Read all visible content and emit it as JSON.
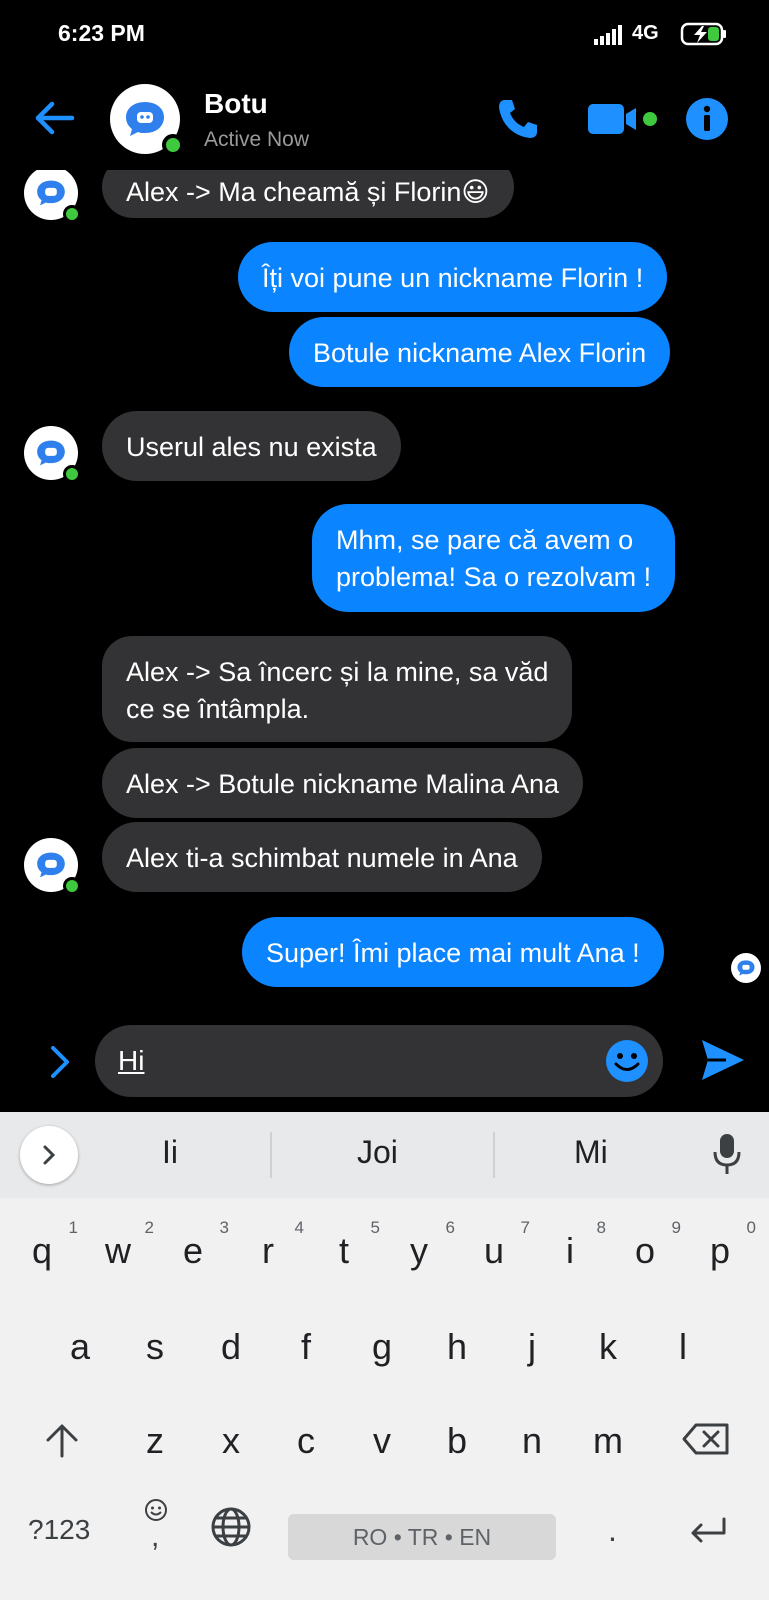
{
  "status_bar": {
    "time": "6:23 PM",
    "network": "4G"
  },
  "header": {
    "name": "Botu",
    "status": "Active Now"
  },
  "messages": [
    {
      "from": "in",
      "text": "Alex -> Ma cheamă și Florin😃"
    },
    {
      "from": "out",
      "text": "Îți voi pune un nickname Florin !"
    },
    {
      "from": "out",
      "text": "Botule nickname Alex Florin"
    },
    {
      "from": "in",
      "text": "Userul ales nu exista"
    },
    {
      "from": "out",
      "text": "Mhm, se pare că avem o"
    },
    {
      "from": "out",
      "text": "problema! Sa o rezolvam !"
    },
    {
      "from": "in",
      "text": "Alex -> Sa încerc și la mine, sa văd"
    },
    {
      "from": "in",
      "text": "ce se întâmpla."
    },
    {
      "from": "in",
      "text": "Alex -> Botule nickname Malina Ana"
    },
    {
      "from": "in",
      "text": "Alex ti-a schimbat numele in Ana"
    },
    {
      "from": "out",
      "text": "Super! Îmi place mai mult Ana !"
    }
  ],
  "composer": {
    "text": "Hi"
  },
  "keyboard": {
    "suggestions": [
      "Ii",
      "Joi",
      "Mi"
    ],
    "row1": [
      {
        "k": "q",
        "h": "1"
      },
      {
        "k": "w",
        "h": "2"
      },
      {
        "k": "e",
        "h": "3"
      },
      {
        "k": "r",
        "h": "4"
      },
      {
        "k": "t",
        "h": "5"
      },
      {
        "k": "y",
        "h": "6"
      },
      {
        "k": "u",
        "h": "7"
      },
      {
        "k": "i",
        "h": "8"
      },
      {
        "k": "o",
        "h": "9"
      },
      {
        "k": "p",
        "h": "0"
      }
    ],
    "row2": [
      "a",
      "s",
      "d",
      "f",
      "g",
      "h",
      "j",
      "k",
      "l"
    ],
    "row3": [
      "z",
      "x",
      "c",
      "v",
      "b",
      "n",
      "m"
    ],
    "symbols": "?123",
    "comma": ",",
    "period": ".",
    "space_label": "RO • TR • EN"
  },
  "colors": {
    "accent": "#0a84ff",
    "incoming_bubble": "#333335",
    "online": "#3ec93f"
  }
}
